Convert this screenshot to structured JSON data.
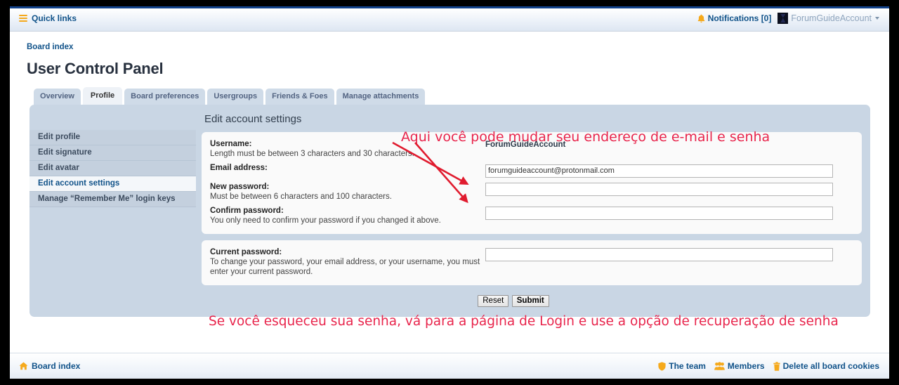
{
  "navbar": {
    "quick_links": "Quick links",
    "notifications": "Notifications [0]",
    "account": "ForumGuideAccount",
    "icons": {
      "menu": "hamburger-icon",
      "bell": "bell-icon",
      "avatar": "user-avatar",
      "caret": "chevron-down-icon"
    }
  },
  "breadcrumb": {
    "board_index": "Board index"
  },
  "page": {
    "title": "User Control Panel"
  },
  "tabs": [
    {
      "label": "Overview",
      "active": false
    },
    {
      "label": "Profile",
      "active": true
    },
    {
      "label": "Board preferences",
      "active": false
    },
    {
      "label": "Usergroups",
      "active": false
    },
    {
      "label": "Friends & Foes",
      "active": false
    },
    {
      "label": "Manage attachments",
      "active": false
    }
  ],
  "sidebar": {
    "items": [
      {
        "label": "Edit profile",
        "active": false
      },
      {
        "label": "Edit signature",
        "active": false
      },
      {
        "label": "Edit avatar",
        "active": false
      },
      {
        "label": "Edit account settings",
        "active": true
      },
      {
        "label": "Manage “Remember Me” login keys",
        "active": false
      }
    ]
  },
  "form": {
    "heading": "Edit account settings",
    "username": {
      "label": "Username:",
      "hint": "Length must be between 3 characters and 30 characters.",
      "value": "ForumGuideAccount"
    },
    "email": {
      "label": "Email address:",
      "hint": "",
      "value": "forumguideaccount@protonmail.com"
    },
    "new_password": {
      "label": "New password:",
      "hint": "Must be between 6 characters and 100 characters.",
      "value": ""
    },
    "confirm_password": {
      "label": "Confirm password:",
      "hint": "You only need to confirm your password if you changed it above.",
      "value": ""
    },
    "current_password": {
      "label": "Current password:",
      "hint": "To change your password, your email address, or your username, you must enter your current password.",
      "value": ""
    },
    "buttons": {
      "reset": "Reset",
      "submit": "Submit"
    }
  },
  "annotations": {
    "top": "Aqui você pode mudar seu endereço de e-mail e senha",
    "bottom": "Se você esqueceu sua senha, vá para a página de Login e use a opção de recuperação de senha",
    "color": "#e8254c"
  },
  "footer": {
    "board_index": "Board index",
    "the_team": "The team",
    "members": "Members",
    "delete_cookies": "Delete all board cookies",
    "icons": {
      "home": "home-icon",
      "shield": "shield-icon",
      "members": "people-icon",
      "trash": "trash-icon"
    }
  },
  "colors": {
    "accent_orange": "#f5a91c",
    "link_blue": "#105289",
    "panel_blue": "#c9d6e4",
    "navbar_top": "#12428b"
  }
}
